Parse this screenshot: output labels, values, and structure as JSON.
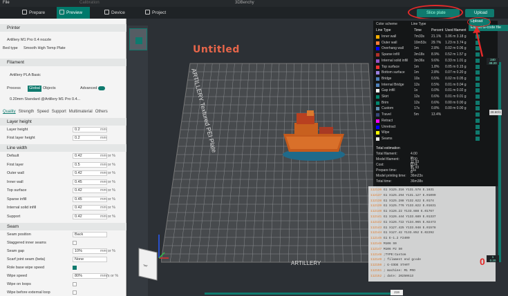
{
  "window": {
    "file_menu": "File",
    "doc_name": "Calibration",
    "title": "3DBenchy"
  },
  "tabs": [
    {
      "label": "Prepare"
    },
    {
      "label": "Preview"
    },
    {
      "label": "Device"
    },
    {
      "label": "Project"
    }
  ],
  "toolbar": {
    "slice_plate": "Slice plate",
    "upload": "Upload",
    "export": "Export G-code file"
  },
  "printer": {
    "section": "Printer",
    "name": "Artillery M1 Pro 0.4 nozzle",
    "bed_label": "Bed type",
    "bed_value": "Smooth High Temp Plate"
  },
  "filament": {
    "section": "Filament",
    "name": "Artillery PLA Basic"
  },
  "process": {
    "section": "Process",
    "global": "Global",
    "objects": "Objects",
    "advanced": "Advanced",
    "preset": "0.20mm Standard @Artillery M1 Pro 0.4..."
  },
  "subtabs": [
    "Quality",
    "Strength",
    "Speed",
    "Support",
    "Multimaterial",
    "Others"
  ],
  "quality": {
    "layer_height_section": "Layer height",
    "layer_height": {
      "label": "Layer height",
      "value": "0.2",
      "unit": "mm"
    },
    "first_layer_height": {
      "label": "First layer height",
      "value": "0.2",
      "unit": "mm"
    },
    "line_width_section": "Line width",
    "lw": [
      {
        "label": "Default",
        "value": "0.42",
        "unit": "mm or %"
      },
      {
        "label": "First layer",
        "value": "0.5",
        "unit": "mm or %"
      },
      {
        "label": "Outer wall",
        "value": "0.42",
        "unit": "mm or %"
      },
      {
        "label": "Inner wall",
        "value": "0.45",
        "unit": "mm or %"
      },
      {
        "label": "Top surface",
        "value": "0.42",
        "unit": "mm or %"
      },
      {
        "label": "Sparse infill",
        "value": "0.45",
        "unit": "mm or %"
      },
      {
        "label": "Internal solid infill",
        "value": "0.42",
        "unit": "mm or %"
      },
      {
        "label": "Support",
        "value": "0.42",
        "unit": "mm or %"
      }
    ],
    "seam_section": "Seam",
    "seam_position": {
      "label": "Seam position",
      "value": "Back"
    },
    "staggered": {
      "label": "Staggered inner seams"
    },
    "seam_gap": {
      "label": "Seam gap",
      "value": "10%",
      "unit": "mm or %"
    },
    "scarf": {
      "label": "Scarf joint seam (beta)",
      "value": "None"
    },
    "role_wipe": {
      "label": "Role base wipe speed"
    },
    "wipe_speed": {
      "label": "Wipe speed",
      "value": "80%",
      "unit": "mm/s or %"
    },
    "wipe_loops": {
      "label": "Wipe on loops"
    },
    "wipe_before": {
      "label": "Wipe before external loop"
    }
  },
  "plate": {
    "title": "Untitled",
    "brand": "ARTILLERY",
    "plate_text": "ARTILLERY Textured PEI Plate"
  },
  "legend": {
    "color_scheme": "Color scheme",
    "line_type": "Line Type",
    "headers": [
      "Line Type",
      "Time",
      "Percent",
      "Used filament"
    ],
    "rows": [
      {
        "name": "Inner wall",
        "time": "7m33s",
        "pct": "21.1%",
        "used": "1.06 m 3.18 g",
        "color": "#ffb000"
      },
      {
        "name": "Outer wall",
        "time": "10m53s",
        "pct": "29.7%",
        "used": "1.23 m 3.74 g",
        "color": "#ff7d38"
      },
      {
        "name": "Overhang wall",
        "time": "1m",
        "pct": "2.8%",
        "used": "0.02 m 0.06 g",
        "color": "#0000ff"
      },
      {
        "name": "Sparse infill",
        "time": "3m18s",
        "pct": "8.9%",
        "used": "0.52 m 1.57 g",
        "color": "#b03029"
      },
      {
        "name": "Internal solid infill",
        "time": "3m36s",
        "pct": "9.6%",
        "used": "0.33 m 1.01 g",
        "color": "#9654cc"
      },
      {
        "name": "Top surface",
        "time": "1m",
        "pct": "1.8%",
        "used": "0.05 m 0.15 g",
        "color": "#f03333"
      },
      {
        "name": "Bottom surface",
        "time": "1m",
        "pct": "2.8%",
        "used": "0.07 m 0.20 g",
        "color": "#9a7ee0"
      },
      {
        "name": "Bridge",
        "time": "10s",
        "pct": "0.5%",
        "used": "0.02 m 0.05 g",
        "color": "#4d80ba"
      },
      {
        "name": "Internal Bridge",
        "time": "12s",
        "pct": "0.5%",
        "used": "0.01 m 0.04 g",
        "color": "#4d80ba"
      },
      {
        "name": "Gap infill",
        "time": "1s",
        "pct": "0.0%",
        "used": "0.01 m 0.02 g",
        "color": "#ffffff"
      },
      {
        "name": "Skirt",
        "time": "12s",
        "pct": "0.6%",
        "used": "0.01 m 0.01 g",
        "color": "#00876e"
      },
      {
        "name": "Brim",
        "time": "12s",
        "pct": "0.6%",
        "used": "0.00 m 0.00 g",
        "color": "#00876e"
      },
      {
        "name": "Custom",
        "time": "17s",
        "pct": "0.8%",
        "used": "0.00 m 0.00 g",
        "color": "#5e8fb1"
      },
      {
        "name": "Travel",
        "time": "5m",
        "pct": "13.4%",
        "used": "",
        "color": "#38487a"
      },
      {
        "name": "Retract",
        "time": "",
        "pct": "",
        "used": "",
        "color": "#ff00ff"
      },
      {
        "name": "Unretract",
        "time": "",
        "pct": "",
        "used": "",
        "color": "#0000ff"
      },
      {
        "name": "Wipe",
        "time": "",
        "pct": "",
        "used": "",
        "color": "#ffff00"
      },
      {
        "name": "Seams",
        "time": "",
        "pct": "",
        "used": "",
        "color": "#e6e6e6"
      }
    ],
    "estimation_title": "Total estimation",
    "estimation": [
      {
        "k": "Total filament:",
        "v": "4.00 m    11.93 g"
      },
      {
        "k": "Model filament:",
        "v": "4.00 m    11.93 g"
      },
      {
        "k": "Cost:",
        "v": "0.24"
      },
      {
        "k": "Prepare time:",
        "v": "16s"
      },
      {
        "k": "Model printing time:",
        "v": "36m23s"
      },
      {
        "k": "Total time:",
        "v": "36m38s"
      }
    ]
  },
  "gcode": [
    {
      "n": "112136",
      "t": "G1 X125.316 Y131.578 E.1631"
    },
    {
      "n": "112137",
      "t": "G1 X125.294 Y131.127 E.01099"
    },
    {
      "n": "112138",
      "t": "G1 X125.288 Y132.622 E.0174"
    },
    {
      "n": "112139",
      "t": "G1 X125.776 Y133.822 E.01631"
    },
    {
      "n": "112140",
      "t": "G1 X126.22 Y133.888 E.01767"
    },
    {
      "n": "112141",
      "t": "G1 X126.444 Y133.689 E.01337"
    },
    {
      "n": "112142",
      "t": "G1 X126.722 Y134.065 E.02473"
    },
    {
      "n": "112143",
      "t": "G1 X127.425 Y133.948 E.01578"
    },
    {
      "n": "112144",
      "t": "G1 X127.42 Y133.852 E.02292"
    },
    {
      "n": "112145",
      "t": "G1 E-1.2 F2400"
    },
    {
      "n": "112146",
      "t": "M106 S0"
    },
    {
      "n": "112147",
      "t": "M106 P2 S0"
    },
    {
      "n": "112148",
      "t": ";TYPE:Custom"
    },
    {
      "n": "112149",
      "t": "; filament end gcode"
    },
    {
      "n": "112150",
      "t": "; G-CODE START"
    },
    {
      "n": "112151",
      "t": ";         machine: M1 PRO"
    },
    {
      "n": "112152",
      "t": ";         date: 20250613"
    }
  ],
  "layer_slider": {
    "top": "240\n48.20",
    "mid": "28.60/1",
    "bottom": "1\n0.20"
  },
  "move_slider": {
    "value": "219"
  },
  "viewcube": {
    "label": "Top"
  }
}
